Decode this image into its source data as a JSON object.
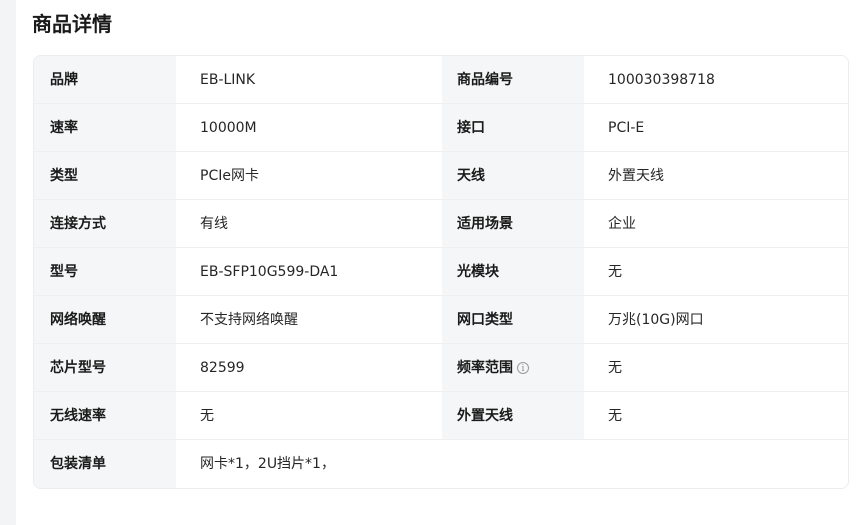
{
  "page": {
    "title": "商品详情"
  },
  "specs": [
    {
      "label": "品牌",
      "value": "EB-LINK",
      "label2": "商品编号",
      "value2": "100030398718"
    },
    {
      "label": "速率",
      "value": "10000M",
      "label2": "接口",
      "value2": "PCI-E"
    },
    {
      "label": "类型",
      "value": "PCIe网卡",
      "label2": "天线",
      "value2": "外置天线"
    },
    {
      "label": "连接方式",
      "value": "有线",
      "label2": "适用场景",
      "value2": "企业"
    },
    {
      "label": "型号",
      "value": "EB-SFP10G599-DA1",
      "label2": "光模块",
      "value2": "无"
    },
    {
      "label": "网络唤醒",
      "value": "不支持网络唤醒",
      "label2": "网口类型",
      "value2": "万兆(10G)网口"
    },
    {
      "label": "芯片型号",
      "value": "82599",
      "label2": "频率范围",
      "value2": "无"
    },
    {
      "label": "无线速率",
      "value": "无",
      "label2": "外置天线",
      "value2": "无"
    }
  ],
  "package": {
    "label": "包装清单",
    "value": "网卡*1，2U挡片*1，"
  },
  "icons": {
    "frequency_info": "info-circle-icon"
  }
}
